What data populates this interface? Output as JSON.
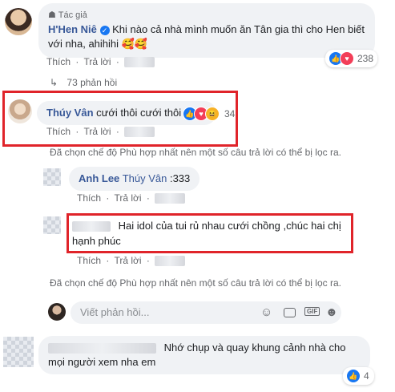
{
  "top_comment": {
    "badge": "Tác giả",
    "name": "H'Hen Niê",
    "verified_icon": "check-badge-icon",
    "text": "Khi nào cả nhà mình muốn ăn Tân gia thì cho Hen biết với nha, ahihihi 🥰🥰",
    "actions": {
      "like": "Thích",
      "reply": "Trả lời"
    },
    "reaction_count": "238"
  },
  "replies_toggle": "73 phản hồi",
  "reply1": {
    "name": "Thúy Vân",
    "text": "cưới thôi cưới thôi",
    "reaction_count": "34",
    "actions": {
      "like": "Thích",
      "reply": "Trả lời"
    }
  },
  "filter_notice_1": "Đã chọn chế độ Phù hợp nhất nên một số câu trả lời có thể bị lọc ra.",
  "reply2": {
    "name": "Anh Lee",
    "mention": "Thúy Vân",
    "text": ":333",
    "actions": {
      "like": "Thích",
      "reply": "Trả lời"
    }
  },
  "reply3": {
    "text": "Hai idol của tui rủ nhau cưới chồng ,chúc hai chị hạnh phúc",
    "actions": {
      "like": "Thích",
      "reply": "Trả lời"
    }
  },
  "filter_notice_2": "Đã chọn chế độ Phù hợp nhất nên một số câu trả lời có thể bị lọc ra.",
  "composer": {
    "placeholder": "Viết phản hồi...",
    "icons": [
      "smile-icon",
      "camera-icon",
      "gif-icon",
      "sticker-icon"
    ]
  },
  "bottom_comment": {
    "text": "Nhớ chụp và quay khung cảnh nhà cho mọi người xem nha em",
    "reaction_count": "4"
  },
  "colors": {
    "link": "#385898",
    "muted": "#65676b",
    "bubble": "#f0f2f5",
    "highlight": "#e0242a",
    "like_blue": "#1877f2"
  }
}
